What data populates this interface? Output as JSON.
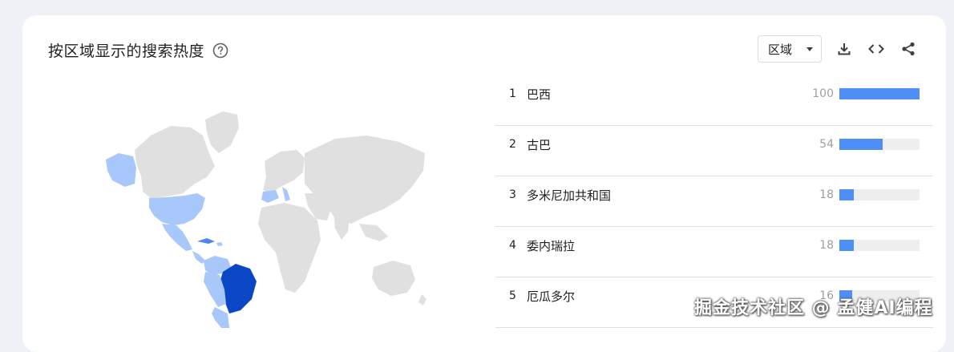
{
  "card": {
    "title": "按区域显示的搜索热度",
    "help_icon": "help-circle-icon",
    "region_select": {
      "selected": "区域"
    },
    "toolbar_icons": [
      "download-icon",
      "embed-code-icon",
      "share-icon"
    ]
  },
  "ranking": {
    "items": [
      {
        "rank": "1",
        "name": "巴西",
        "value": "100",
        "value_num": 100
      },
      {
        "rank": "2",
        "name": "古巴",
        "value": "54",
        "value_num": 54
      },
      {
        "rank": "3",
        "name": "多米尼加共和国",
        "value": "18",
        "value_num": 18
      },
      {
        "rank": "4",
        "name": "委内瑞拉",
        "value": "18",
        "value_num": 18
      },
      {
        "rank": "5",
        "name": "厄瓜多尔",
        "value": "16",
        "value_num": 16
      }
    ]
  },
  "colors": {
    "bar": "#4e8ef7",
    "map_land": "#e0e0e0",
    "map_high": "#0b47c4",
    "map_mid": "#4e86ea",
    "map_low": "#a8c7fa"
  },
  "watermark": "掘金技术社区 @ 孟健AI编程"
}
